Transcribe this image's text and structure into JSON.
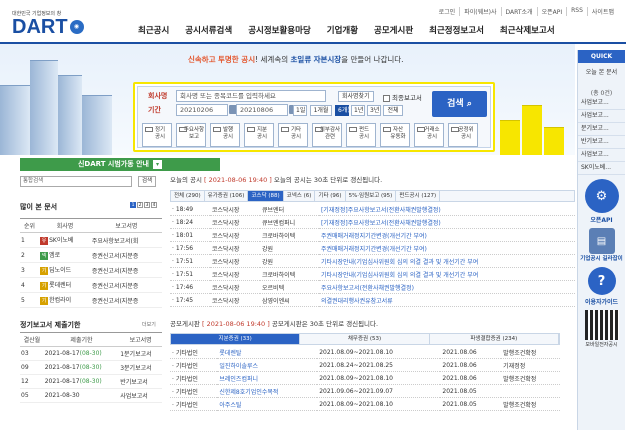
{
  "util": [
    "로그인",
    "파이(웨브)사",
    "DART소개",
    "오픈API",
    "RSS",
    "사이트맵"
  ],
  "logo": {
    "sub": "대한민국 기업정보의 창",
    "main": "DART"
  },
  "gnb": [
    "최근공시",
    "공시서류검색",
    "공시정보활용마당",
    "기업개황",
    "공모게시판",
    "최근정정보고서",
    "최근삭제보고서"
  ],
  "slogan": {
    "p1": "신속하고",
    "p2": "투명한 공시",
    "p3": "! 세계속의",
    "p4": "초일류",
    "p5": "자본시장",
    "p6": "을 만들어 나갑니다."
  },
  "search": {
    "company_label": "회사명",
    "period_label": "기간",
    "company_placeholder": "회사명 또는 종목코드를 입력하세요",
    "select_label": "회사명찾기",
    "final_report": "최종보고서",
    "start_date": "20210206",
    "end_date": "20210806",
    "range_buttons": [
      "1일",
      "1개월",
      "6개월",
      "1년",
      "3년",
      "전체"
    ],
    "range_active": "6개월",
    "go": "검색",
    "categories": [
      [
        "정기",
        "공시"
      ],
      [
        "주요사항",
        "보고"
      ],
      [
        "발행",
        "공시"
      ],
      [
        "지분",
        "공시"
      ],
      [
        "기타",
        "공시"
      ],
      [
        "외부감사",
        "관련"
      ],
      [
        "펀드",
        "공시"
      ],
      [
        "자산",
        "유동화"
      ],
      [
        "거래소",
        "공시"
      ],
      [
        "공정위",
        "공시"
      ]
    ]
  },
  "quick": {
    "head": "QUICK",
    "sub": "오늘 본 문서",
    "count": "(총 0건)",
    "items": [
      "사업보고...",
      "사업보고...",
      "분기보고...",
      "반기보고...",
      "사업보고...",
      "SK이노베..."
    ],
    "links": [
      "오픈API",
      "기업공시 길라잡이",
      "이용자가이드",
      "모바일전자공시"
    ]
  },
  "left": {
    "banner": "신DART 시범가동 안내",
    "search_placeholder": "통합검색",
    "search_btn": "검색",
    "popular_title": "많이 본 문서",
    "pages": [
      "1",
      "2",
      "3",
      "4"
    ],
    "cols": [
      "순위",
      "회사명",
      "보고서명"
    ],
    "rows": [
      {
        "rank": "1",
        "mk": "유",
        "mkc": "#c0392b",
        "company": "SK이노베",
        "report": "주요사항보고서(회"
      },
      {
        "rank": "2",
        "mk": "넥",
        "mkc": "#3e9b4a",
        "company": "엠로",
        "report": "증권신고서(지분증"
      },
      {
        "rank": "3",
        "mk": "기",
        "mkc": "#d6a100",
        "company": "딥노이드",
        "report": "증권신고서(지분증"
      },
      {
        "rank": "4",
        "mk": "기",
        "mkc": "#d6a100",
        "company": "롯데렌터",
        "report": "증권신고서(지분증"
      },
      {
        "rank": "5",
        "mk": "기",
        "mkc": "#d6a100",
        "company": "한컴라이",
        "report": "증권신고서(지분증"
      }
    ],
    "deadline_title": "정기보고서 제출기한",
    "more": "더보기",
    "d_cols": [
      "결산월",
      "제출기한",
      "보고서명"
    ],
    "d_rows": [
      {
        "m": "03",
        "d": "2021-08-17",
        "x": "(08-30)",
        "r": "1분기보고서"
      },
      {
        "m": "09",
        "d": "2021-08-17",
        "x": "(08-30)",
        "r": "3분기보고서"
      },
      {
        "m": "12",
        "d": "2021-08-17",
        "x": "(08-30)",
        "r": "반기보고서"
      },
      {
        "m": "05",
        "d": "2021-08-30",
        "x": "",
        "r": "사업보고서"
      }
    ]
  },
  "today": {
    "p1": "오늘의 공시",
    "time": "[ 2021-08-06 19:40 ]",
    "p2": "오늘의 공시는 30초 단위로 갱신됩니다.",
    "tabs": [
      "전체 (290)",
      "유가증권 (106)",
      "코스닥 (88)",
      "코넥스 (6)",
      "기타 (96)",
      "5%·임원보고 (95)",
      "펀드공시 (127)"
    ],
    "rows": [
      {
        "t": "18:49",
        "m": "코스닥시장",
        "c": "큐브엔터",
        "r": "[기재정정]주요사항보고서(전환사채권발행결정)"
      },
      {
        "t": "18:24",
        "m": "코스닥시장",
        "c": "큐브엔컴퍼니",
        "r": "[기재정정]주요사항보고서(전환사채권발행결정)"
      },
      {
        "t": "18:01",
        "m": "코스닥시장",
        "c": "크로바하이텍",
        "r": "주권매매거래정지기간변경(개선기간 부여)"
      },
      {
        "t": "17:56",
        "m": "코스닥시장",
        "c": "강원",
        "r": "주권매매거래정지기간변경(개선기간 부여)"
      },
      {
        "t": "17:51",
        "m": "코스닥시장",
        "c": "강원",
        "r": "기타시장안내(기업심사위원회 심의 의결 결과 및 개선기간 부여"
      },
      {
        "t": "17:51",
        "m": "코스닥시장",
        "c": "크로바하이텍",
        "r": "기타시장안내(기업심사위원회 심의 의결 결과 및 개선기간 부여"
      },
      {
        "t": "17:46",
        "m": "코스닥시장",
        "c": "오르비텍",
        "r": "주요사항보고서(전환사채권발행결정)"
      },
      {
        "t": "17:45",
        "m": "코스닥시장",
        "c": "삼영이엔씨",
        "r": "의결권대리행사권유참고서류"
      }
    ],
    "more": "더보기"
  },
  "offer": {
    "p1": "공모게시판",
    "time": "[ 2021-08-06 19:40 ]",
    "p2": "공모게시판은 30초 단위로 갱신됩니다.",
    "tabs": [
      "지분증권 (33)",
      "채무증권 (53)",
      "파생결합증권 (234)"
    ],
    "rows": [
      {
        "k": "기타법인",
        "c": "롯데렌탈",
        "p": "2021.08.09~2021.08.10",
        "d": "2021.08.06",
        "s": "발행조건확정"
      },
      {
        "k": "기타법인",
        "c": "일진하이솔루스",
        "p": "2021.08.24~2021.08.25",
        "d": "2021.08.06",
        "s": "기재정정"
      },
      {
        "k": "기타법인",
        "c": "브레인즈컴퍼니",
        "p": "2021.08.09~2021.08.10",
        "d": "2021.08.06",
        "s": "발행조건확정"
      },
      {
        "k": "기타법인",
        "c": "신한제8호기업인수목적",
        "p": "2021.09.06~2021.09.07",
        "d": "2021.08.05",
        "s": ""
      },
      {
        "k": "기타법인",
        "c": "아주스틸",
        "p": "2021.08.09~2021.08.10",
        "d": "2021.08.05",
        "s": "발행조건확정"
      }
    ]
  }
}
